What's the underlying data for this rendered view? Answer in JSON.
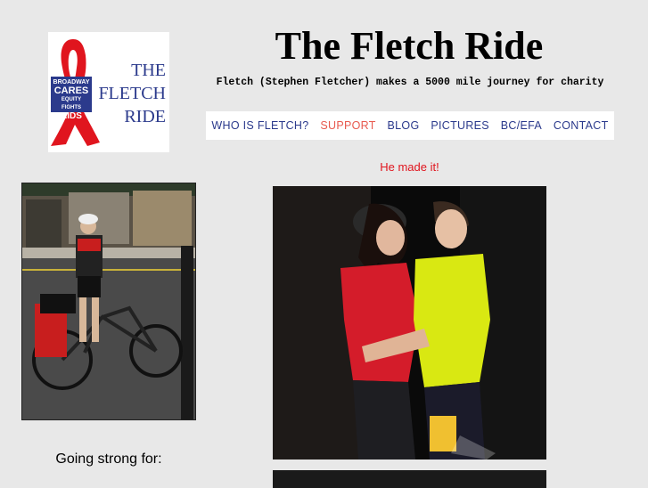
{
  "site": {
    "title": "The Fletch Ride",
    "tagline": "Fletch (Stephen Fletcher) makes a 5000 mile journey for charity"
  },
  "logo": {
    "line1": "THE",
    "line2": "FLETCH",
    "line3": "RIDE",
    "badge": [
      "BROADWAY",
      "CARES",
      "EQUITY",
      "FIGHTS",
      "AIDS"
    ],
    "ribbon_color": "#e0151e",
    "text_color": "#2b3a8c"
  },
  "nav": {
    "items": [
      {
        "label": "WHO IS FLETCH?"
      },
      {
        "label": "SUPPORT"
      },
      {
        "label": "BLOG"
      },
      {
        "label": "PICTURES"
      },
      {
        "label": "BC/EFA"
      },
      {
        "label": "CONTACT"
      }
    ],
    "active_color": "#e85a4f",
    "color": "#2b3a8c"
  },
  "content": {
    "headline": "He made it!"
  },
  "sidebar": {
    "caption": "Going strong for:"
  }
}
